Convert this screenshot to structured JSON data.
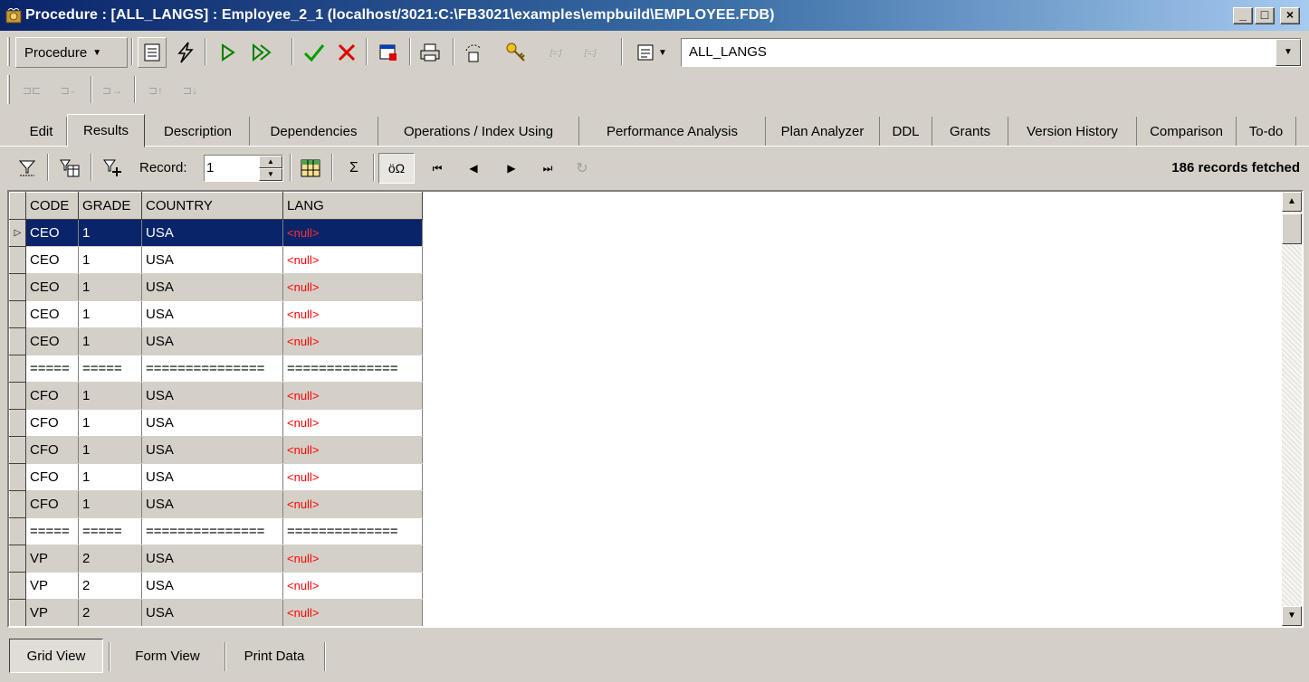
{
  "window": {
    "title": "Procedure : [ALL_LANGS] : Employee_2_1 (localhost/3021:C:\\FB3021\\examples\\empbuild\\EMPLOYEE.FDB)",
    "minimize": "_",
    "maximize": "□",
    "close": "×"
  },
  "toolbar": {
    "object_type": "Procedure",
    "object_name": "ALL_LANGS"
  },
  "tabs": [
    "Edit",
    "Results",
    "Description",
    "Dependencies",
    "Operations / Index Using",
    "Performance Analysis",
    "Plan Analyzer",
    "DDL",
    "Grants",
    "Version History",
    "Comparison",
    "To-do"
  ],
  "active_tab": "Results",
  "record_bar": {
    "record_label": "Record:",
    "record_value": "1",
    "sum_symbol": "Σ",
    "charset_label": "öΩ",
    "status": "186 records fetched"
  },
  "grid": {
    "columns": [
      "CODE",
      "GRADE",
      "COUNTRY",
      "LANG"
    ],
    "rows": [
      [
        "CEO",
        "1",
        "USA",
        "<null>"
      ],
      [
        "CEO",
        "1",
        "USA",
        "<null>"
      ],
      [
        "CEO",
        "1",
        "USA",
        "<null>"
      ],
      [
        "CEO",
        "1",
        "USA",
        "<null>"
      ],
      [
        "CEO",
        "1",
        "USA",
        "<null>"
      ],
      [
        "=====",
        "=====",
        "===============",
        "=============="
      ],
      [
        "CFO",
        "1",
        "USA",
        "<null>"
      ],
      [
        "CFO",
        "1",
        "USA",
        "<null>"
      ],
      [
        "CFO",
        "1",
        "USA",
        "<null>"
      ],
      [
        "CFO",
        "1",
        "USA",
        "<null>"
      ],
      [
        "CFO",
        "1",
        "USA",
        "<null>"
      ],
      [
        "=====",
        "=====",
        "===============",
        "=============="
      ],
      [
        "VP",
        "2",
        "USA",
        "<null>"
      ],
      [
        "VP",
        "2",
        "USA",
        "<null>"
      ],
      [
        "VP",
        "2",
        "USA",
        "<null>"
      ]
    ],
    "selected_row": 0
  },
  "views": [
    "Grid View",
    "Form View",
    "Print Data"
  ],
  "active_view": "Grid View",
  "colors": {
    "title_start": "#0a246a",
    "title_end": "#a6caf0",
    "selection": "#0a246a",
    "null_text": "#ff0000",
    "face": "#d4d0c8"
  }
}
